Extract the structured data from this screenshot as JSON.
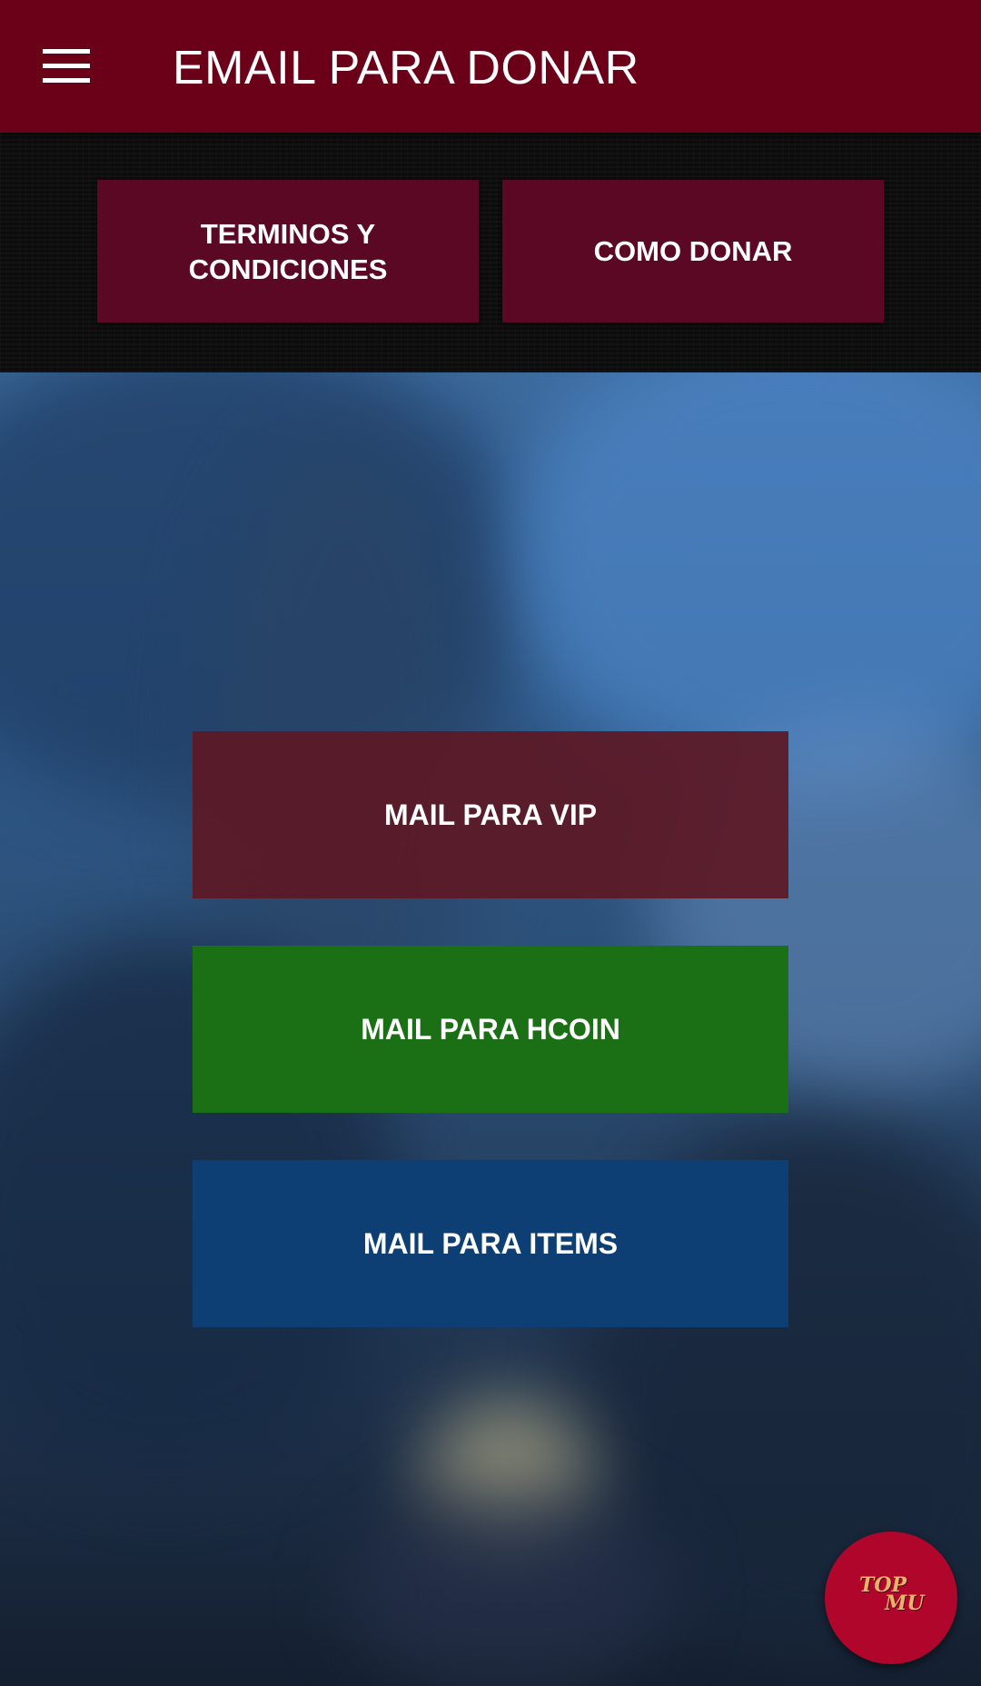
{
  "appbar": {
    "title": "EMAIL PARA DONAR",
    "menu_icon": "hamburger-menu-icon"
  },
  "top_buttons": {
    "terms_label": "TERMINOS Y\nCONDICIONES",
    "como_donar_label": "COMO DONAR"
  },
  "actions": {
    "vip_label": "MAIL PARA VIP",
    "hcoin_label": "MAIL PARA HCOIN",
    "items_label": "MAIL PARA ITEMS"
  },
  "badge": {
    "logo_text_top": "TOP",
    "logo_text_bottom": "MU"
  },
  "colors": {
    "appbar": "#6b0019",
    "strip_button": "#5a0823",
    "vip_button": "#5c1824",
    "hcoin_button": "#1b7015",
    "items_button": "#0d3f75",
    "badge": "#b0062c"
  }
}
